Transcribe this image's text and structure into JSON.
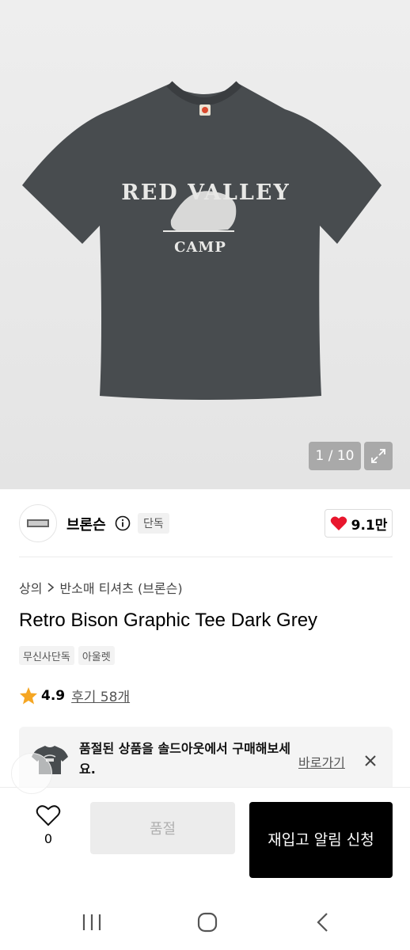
{
  "product_image": {
    "print_top": "RED VALLEY",
    "print_bottom": "CAMP",
    "counter": "1 / 10",
    "tee_color": "#484c4f"
  },
  "brand": {
    "name": "브론슨",
    "badge": "단독",
    "likes": "9.1만",
    "heart_color": "#e8162d"
  },
  "breadcrumb": {
    "category": "상의",
    "subcategory": "반소매 티셔츠 (브론슨)"
  },
  "product": {
    "title": "Retro Bison Graphic Tee Dark Grey",
    "tags": [
      "무신사단독",
      "아울렛"
    ],
    "rating": "4.9",
    "reviews": "후기 58개",
    "star_color": "#f5a623"
  },
  "banner": {
    "text": "품절된 상품을 솔드아웃에서 구매해보세요.",
    "link": "바로가기"
  },
  "bottom_bar": {
    "wish_count": "0",
    "soldout_label": "품절",
    "restock_label": "재입고 알림 신청"
  },
  "icons": [
    "expand-icon",
    "info-icon",
    "heart-icon",
    "star-icon",
    "chevron-right-icon",
    "close-icon",
    "heart-outline-icon",
    "recent-apps-icon",
    "home-icon",
    "back-icon"
  ]
}
